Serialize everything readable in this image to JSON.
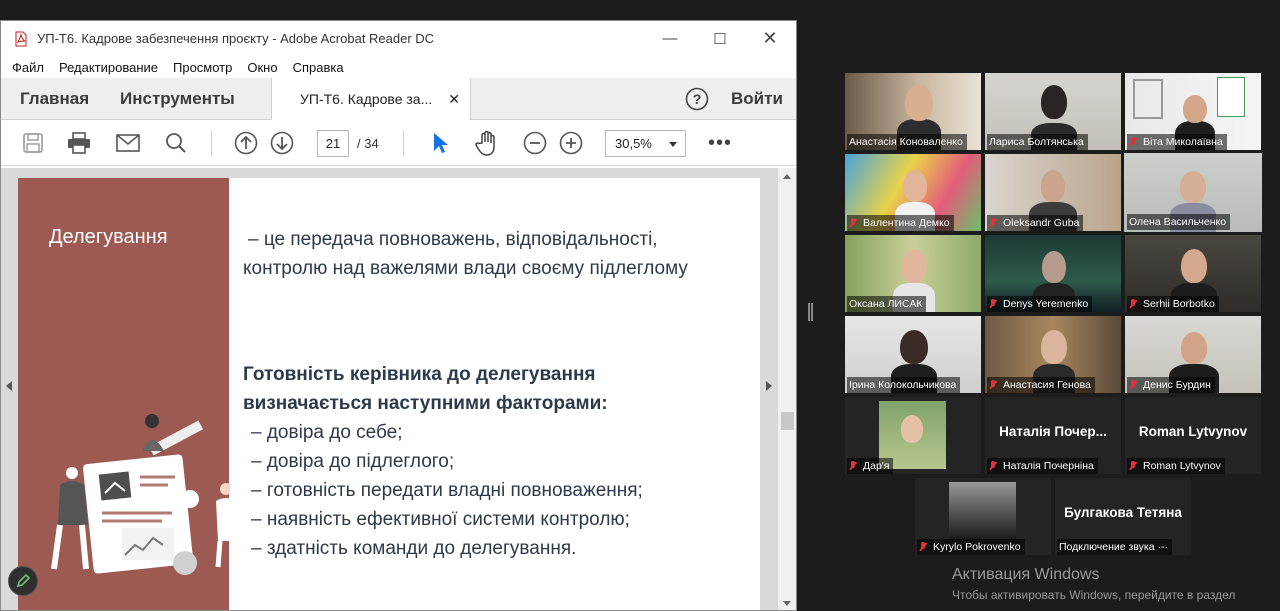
{
  "acrobat": {
    "window_title": "УП-Т6. Кадрове забезпечення проєкту - Adobe Acrobat Reader DC",
    "menu": [
      "Файл",
      "Редактирование",
      "Просмотр",
      "Окно",
      "Справка"
    ],
    "tab_home": "Главная",
    "tab_tools": "Инструменты",
    "doc_tab": "УП-Т6. Кадрове за...",
    "signin": "Войти",
    "page_current": "21",
    "page_total": "/ 34",
    "zoom": "30,5%"
  },
  "slide": {
    "side_title": "Делегування",
    "definition_line1": "– це передача повноважень, відповідальності,",
    "definition_line2": "контролю над важелями влади своєму підлеглому",
    "heading_line1": "Готовність керівника до делегування",
    "heading_line2": "визначається наступними факторами:",
    "factors": [
      "– довіра до себе;",
      "– довіра до підлеглого;",
      "– готовність передати владні повноваження;",
      "– наявність ефективної системи контролю;",
      "– здатність команди до делегування."
    ]
  },
  "participants": [
    {
      "name": "Анастасія Коноваленко",
      "muted": false
    },
    {
      "name": "Лариса Болтянська",
      "muted": false
    },
    {
      "name": "Віта Миколаївна",
      "muted": true
    },
    {
      "name": "Валентина Демко",
      "muted": true
    },
    {
      "name": "Oleksandr Guba",
      "muted": true
    },
    {
      "name": "Олена Васильченко",
      "muted": false,
      "active_speaker": true
    },
    {
      "name": "Оксана ЛИСАК",
      "muted": false
    },
    {
      "name": "Denys Yeremenko",
      "muted": true
    },
    {
      "name": "Serhii Borbotko",
      "muted": true
    },
    {
      "name": "Ірина Колокольчикова",
      "muted": false
    },
    {
      "name": "Анастасия Генова",
      "muted": true
    },
    {
      "name": "Денис Бурдин",
      "muted": true
    },
    {
      "name": "Дар'я",
      "muted": true
    },
    {
      "name": "Наталія Почерніна",
      "muted": true,
      "big_label": "Наталія Почер..."
    },
    {
      "name": "Roman Lytvynov",
      "muted": true,
      "big_label": "Roman Lytvynov"
    },
    {
      "name": "Kyrylo Pokrovenko",
      "muted": true
    },
    {
      "name": "Подключение звука",
      "muted": false,
      "big_label": "Булгакова Тетяна",
      "suffix": "·-·"
    }
  ],
  "windows_activation": {
    "title": "Активация Windows",
    "subtitle": "Чтобы активировать Windows, перейдите в раздел"
  },
  "colors": {
    "slide_accent": "#9c5a52",
    "active_speaker": "#c8e84f",
    "mute_red": "#e0313c"
  }
}
